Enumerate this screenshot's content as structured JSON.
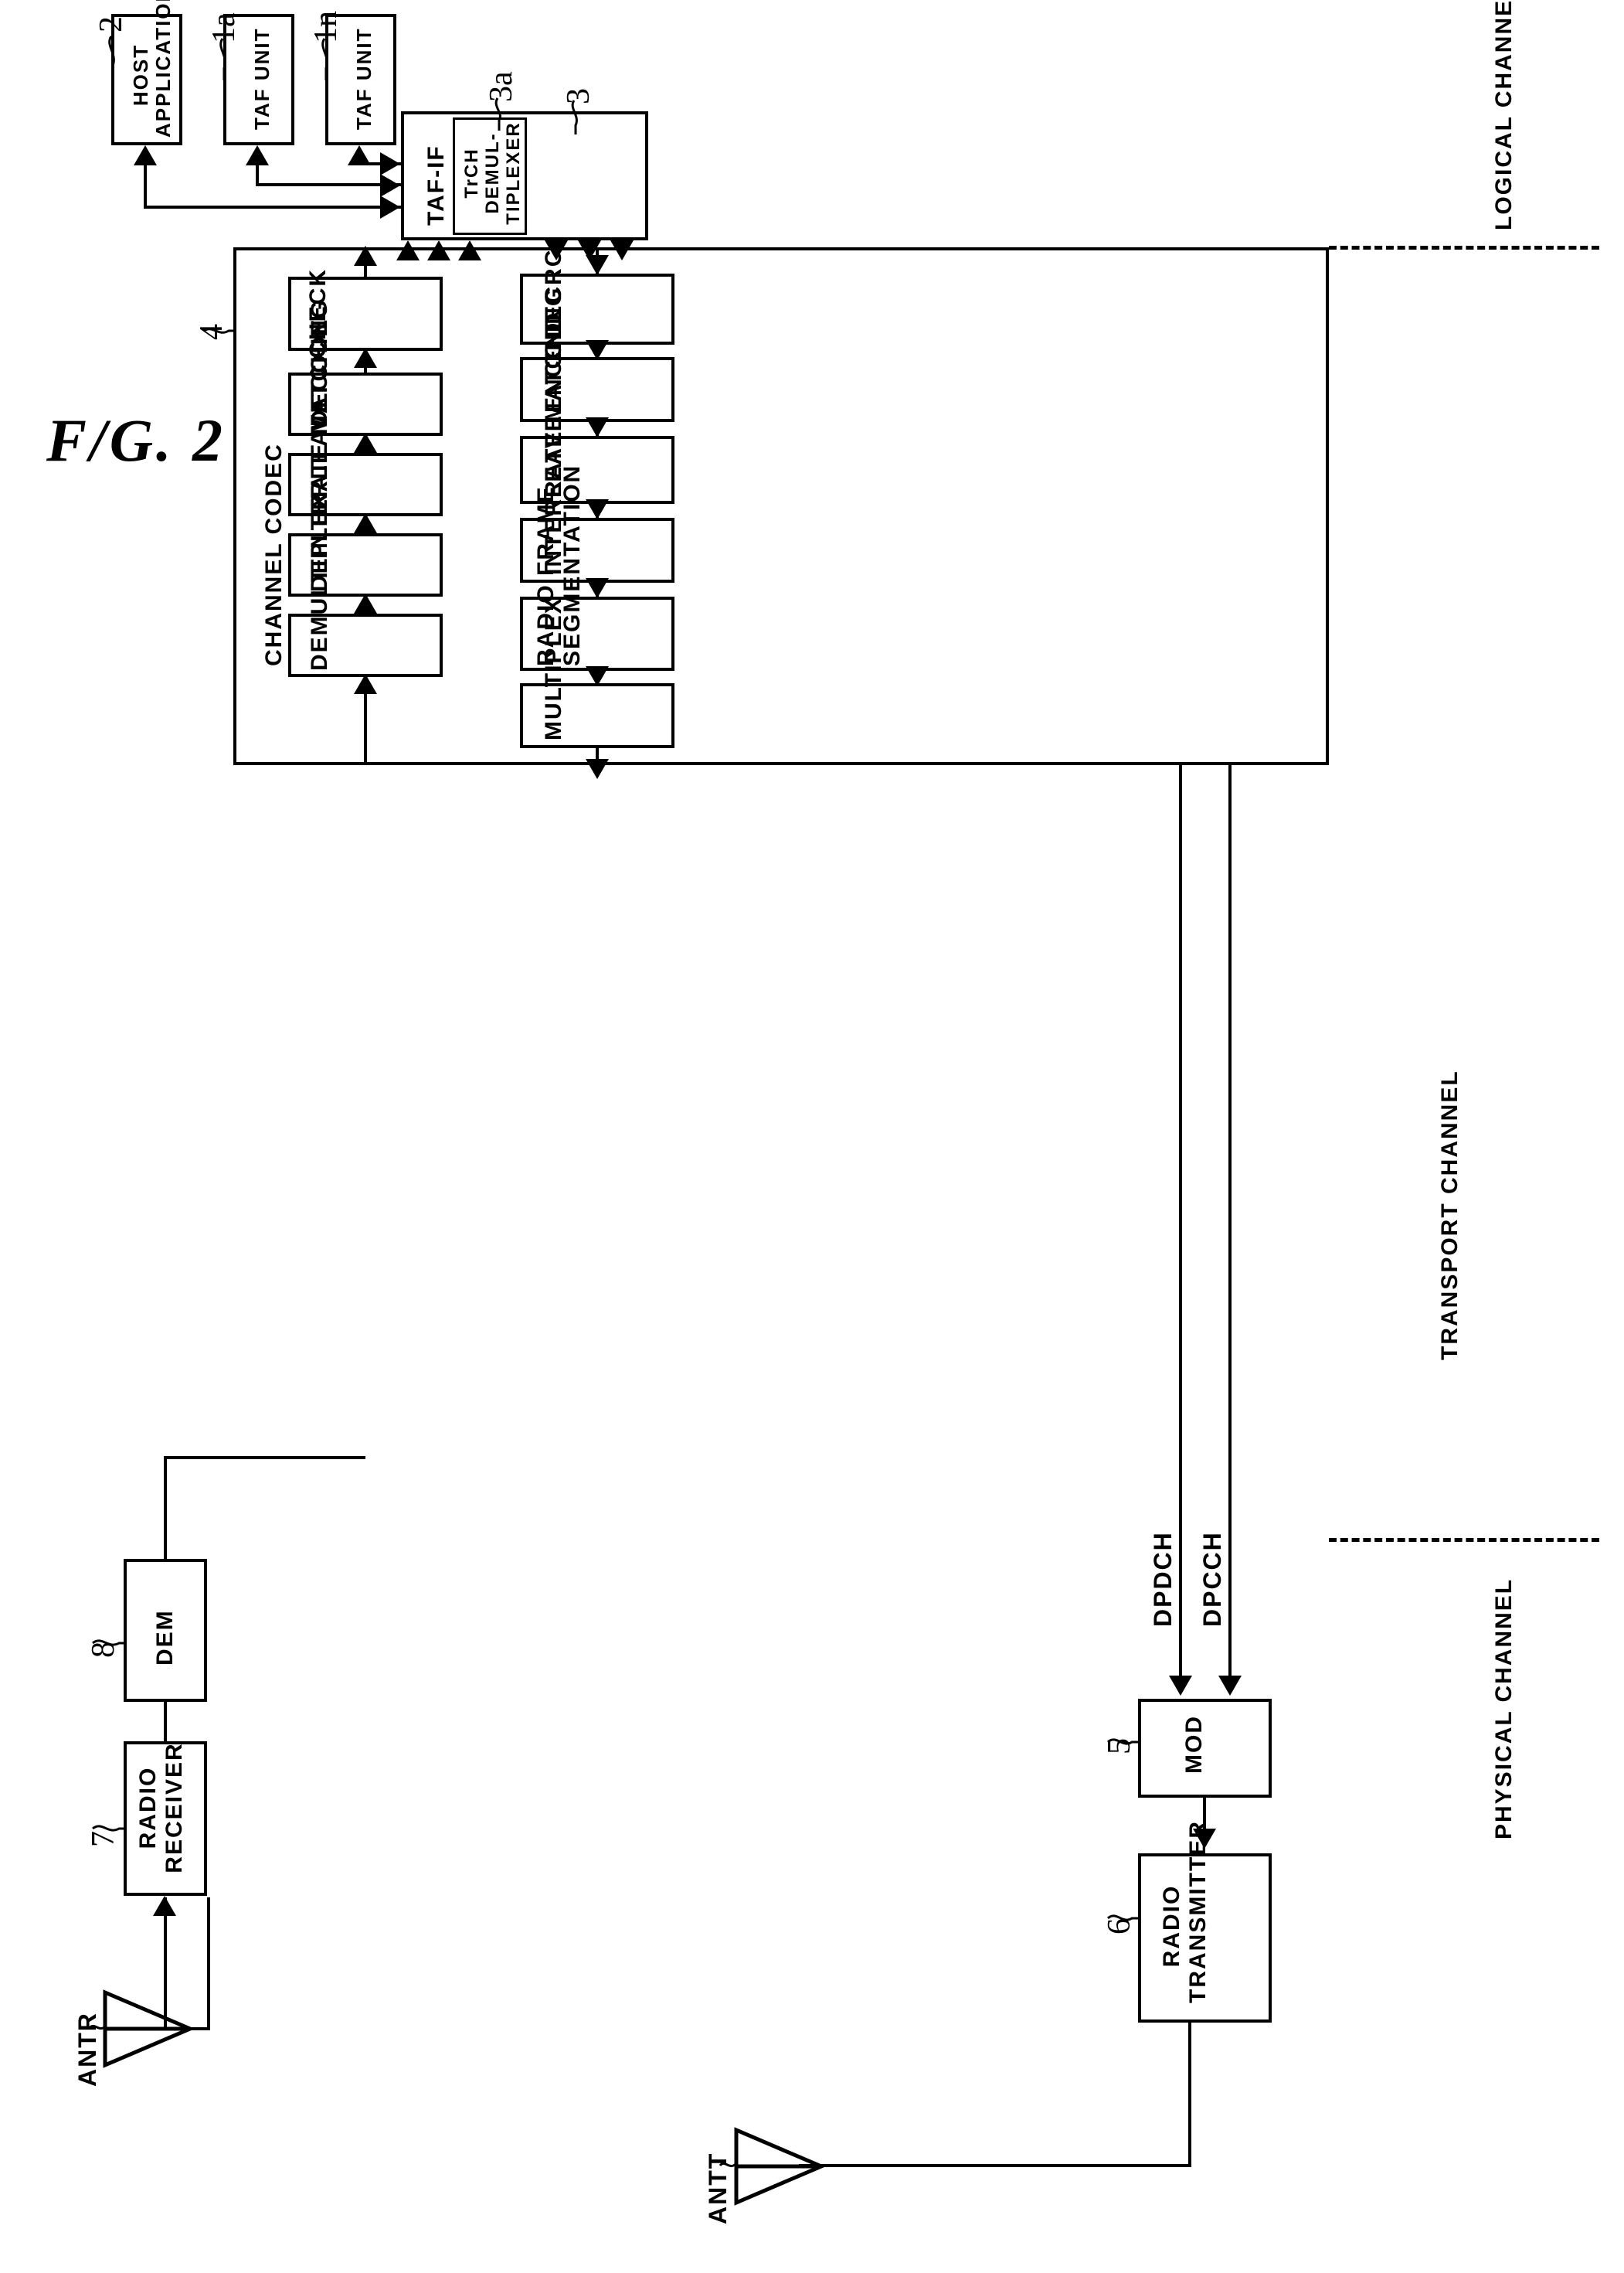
{
  "figure": {
    "title": "F/G. 2"
  },
  "blocks": {
    "host_application": {
      "label": "HOST\nAPPLICATION",
      "ref": "2"
    },
    "taf_unit_a": {
      "label": "TAF UNIT",
      "ref": "1a"
    },
    "taf_unit_n": {
      "label": "TAF UNIT",
      "ref": "1n"
    },
    "taf_if": {
      "label": "TAF-IF",
      "ref": "3"
    },
    "trch_demultiplexer": {
      "label": "TrCH\nDEMUL-\nTIPLEXER",
      "ref": "3a"
    },
    "channel_codec": {
      "label": "CHANNEL CODEC",
      "ref": "4"
    },
    "mod": {
      "label": "MOD",
      "ref": "5"
    },
    "radio_transmitter": {
      "label": "RADIO\nTRANSMITTER",
      "ref": "6"
    },
    "radio_receiver": {
      "label": "RADIO\nRECEIVER",
      "ref": "7"
    },
    "dem": {
      "label": "DEM",
      "ref": "8"
    }
  },
  "receive_chain": [
    {
      "label": "DEMULTIPLEX"
    },
    {
      "label": "DEINTERLEAVE"
    },
    {
      "label": "RATE MATCHING"
    },
    {
      "label": "DECODE"
    },
    {
      "label": "CRC CHECK"
    }
  ],
  "transmit_chain": [
    {
      "label": "APPEND CRC"
    },
    {
      "label": "ENCODE"
    },
    {
      "label": "RATE MATCHING"
    },
    {
      "label": "INTERLEAVE"
    },
    {
      "label": "RADIO FRAME\nSEGMENTATION"
    },
    {
      "label": "MULTIPLEX"
    }
  ],
  "channel_layers": [
    {
      "name": "LOGICAL CHANNEL"
    },
    {
      "name": "TRANSPORT CHANNEL"
    },
    {
      "name": "PHYSICAL CHANNEL"
    }
  ],
  "signals": {
    "dpdch": "DPDCH",
    "dpcch": "DPCCH"
  },
  "antennas": {
    "receive": "ANTR",
    "transmit": "ANTT"
  },
  "misc": {
    "ellipsis": "· · ·"
  },
  "colors": {
    "ink": "#000000",
    "paper": "#ffffff"
  }
}
